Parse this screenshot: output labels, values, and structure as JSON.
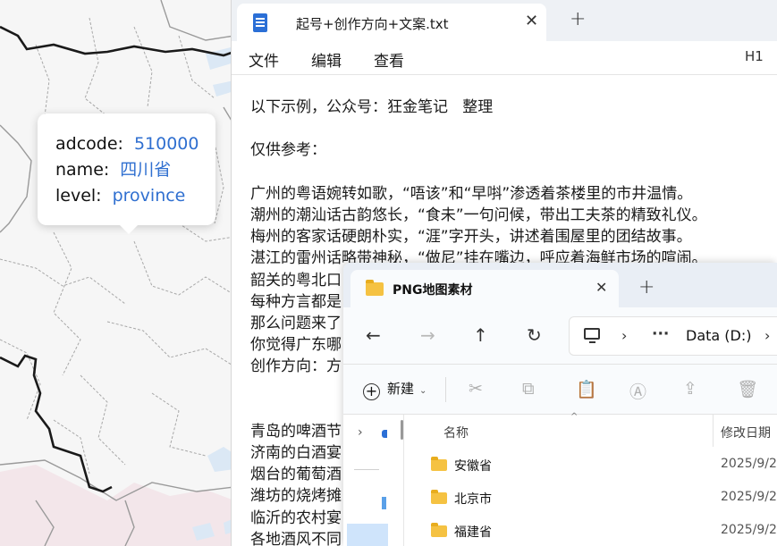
{
  "map": {
    "tooltip": {
      "adcode_key": "adcode:",
      "adcode_value": "510000",
      "name_key": "name:",
      "name_value": "四川省",
      "level_key": "level:",
      "level_value": "province"
    }
  },
  "notepad": {
    "tab_title": "起号+创作方向+文案.txt",
    "close_glyph": "✕",
    "new_tab_glyph": "+",
    "menu": {
      "file": "文件",
      "edit": "编辑",
      "view": "查看"
    },
    "heading_level": "H1",
    "lines": [
      "以下示例，公众号：狂金笔记   整理",
      "",
      "仅供参考：",
      "",
      "广州的粤语婉转如歌，“唔该”和“早唞”渗透着茶楼里的市井温情。",
      "潮州的潮汕话古韵悠长，“食未”一句问候，带出工夫茶的精致礼仪。",
      "梅州的客家话硬朗朴实，“涯”字开头，讲述着围屋里的团结故事。",
      "湛江的雷州话略带神秘，“做尼”挂在嘴边，呼应着海鲜市场的喧闹。",
      "韶关的粤北口",
      "每种方言都是",
      "那么问题来了",
      "你觉得广东哪",
      "创作方向：方",
      "",
      "",
      "青岛的啤酒节",
      "济南的白酒宴",
      "烟台的葡萄酒",
      "潍坊的烧烤摊",
      "临沂的农村宴",
      "各地酒风不同"
    ]
  },
  "explorer": {
    "tab_title": "PNG地图素材",
    "close_glyph": "✕",
    "new_tab_glyph": "+",
    "nav": {
      "back": "←",
      "forward": "→",
      "up": "↑",
      "refresh": "↻"
    },
    "address": {
      "chevron": "›",
      "more": "···",
      "drive": "Data (D:)"
    },
    "toolbar": {
      "new_label": "新建",
      "new_caret": "⌄",
      "cut": "✂",
      "copy": "⧉",
      "paste": "📋",
      "rename": "Ⓐ",
      "share": "⇪",
      "delete": "🗑"
    },
    "columns": {
      "name": "名称",
      "date": "修改日期",
      "sort_caret": "^"
    },
    "sidebar": {
      "chevron": "›"
    },
    "files": [
      {
        "name": "安徽省",
        "date": "2025/9/2"
      },
      {
        "name": "北京市",
        "date": "2025/9/2"
      },
      {
        "name": "福建省",
        "date": "2025/9/2"
      }
    ]
  }
}
